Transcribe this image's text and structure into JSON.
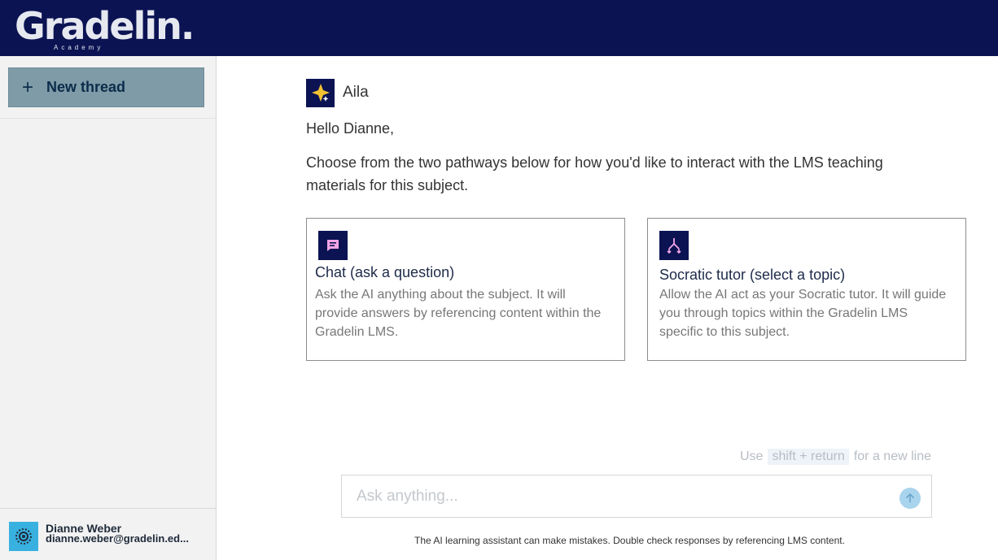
{
  "brand": {
    "name": "Gradelin.",
    "subtitle": "Academy"
  },
  "sidebar": {
    "new_thread_label": "New thread",
    "user": {
      "name": "Dianne Weber",
      "email": "dianne.weber@gradelin.ed..."
    }
  },
  "assistant": {
    "name": "Aila",
    "greeting": "Hello Dianne,",
    "intro": "Choose from the two pathways below for how you'd like to interact with the LMS teaching materials for this subject."
  },
  "pathways": [
    {
      "title": "Chat (ask a question)",
      "description": "Ask the AI anything about the subject. It will provide answers by referencing content within the Gradelin LMS.",
      "icon": "chat-icon"
    },
    {
      "title": "Socratic tutor (select a topic)",
      "description": "Allow the AI act as your Socratic tutor. It will guide you through topics within the Gradelin LMS specific to this subject.",
      "icon": "branch-icon"
    }
  ],
  "composer": {
    "hint_prefix": "Use",
    "hint_key": "shift + return",
    "hint_suffix": "for a new line",
    "placeholder": "Ask anything...",
    "disclaimer": "The AI learning assistant can make mistakes. Double check responses by referencing LMS content."
  },
  "colors": {
    "topbar": "#0b1353",
    "new_thread_bg": "#7e9ba7",
    "icon_accent": "#f4a6e6",
    "send_button": "#a9d4ee",
    "avatar_bg": "#39b1e0"
  }
}
